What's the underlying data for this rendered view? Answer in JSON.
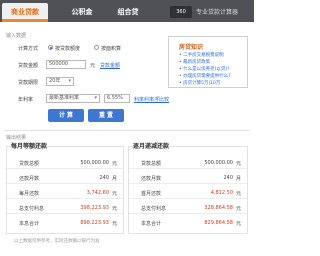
{
  "tabs": [
    {
      "label": "商业贷款"
    },
    {
      "label": "公积金"
    },
    {
      "label": "组合贷"
    }
  ],
  "brand": {
    "logo": "360",
    "subtitle": "专业贷款计算器"
  },
  "input_section": {
    "title": "输入数据"
  },
  "form": {
    "calc_method_label": "计算方式",
    "method_options": [
      "按贷款额度",
      "按面积算"
    ],
    "loan_amount_label": "贷款金额",
    "loan_amount_value": "500000",
    "loan_amount_unit": "元",
    "loan_amount_link": "贷款金额",
    "term_label": "贷款期限",
    "term_value": "20年",
    "rate_label": "年利率",
    "rate_select": "最新基准利率",
    "rate_value": "6.55%",
    "rate_link": "利率利率浮比较"
  },
  "buttons": {
    "calculate": "计 算",
    "reset": "重 置"
  },
  "knowledge": {
    "title": "房贷知识",
    "items": [
      "二手房交易税费说明",
      "最新房贷政策",
      "什么是以房养老(以贷)?",
      "办理房贷需要提供什么?",
      "房贷计算5万|10万"
    ]
  },
  "output_section": {
    "title": "输出结果"
  },
  "equal_installment": {
    "title": "每月等额还款",
    "rows": [
      {
        "label": "贷款总额",
        "value": "500,000.00",
        "unit": "元"
      },
      {
        "label": "还款月数",
        "value": "240",
        "unit": "月"
      },
      {
        "label": "每月还款",
        "value": "3,742.60",
        "unit": "元"
      },
      {
        "label": "总支付利息",
        "value": "398,223.93",
        "unit": "元"
      },
      {
        "label": "本息合计",
        "value": "898,223.93",
        "unit": "元"
      }
    ]
  },
  "equal_principal": {
    "title": "逐月递减还款",
    "rows": [
      {
        "label": "贷款总额",
        "value": "500,000.00",
        "unit": "元"
      },
      {
        "label": "还款月数",
        "value": "240",
        "unit": "月"
      },
      {
        "label": "首月还款",
        "value": "4,812.50",
        "unit": "元"
      },
      {
        "label": "总支付利息",
        "value": "328,864.58",
        "unit": "元"
      },
      {
        "label": "本息合计",
        "value": "829,864.58",
        "unit": "元"
      }
    ]
  },
  "footnote": "以上数据仅供参考，实际还款额以银行为准",
  "colors": {
    "accent": "#e06d1c",
    "button": "#3c77d2",
    "value_red": "#d03a1d"
  }
}
